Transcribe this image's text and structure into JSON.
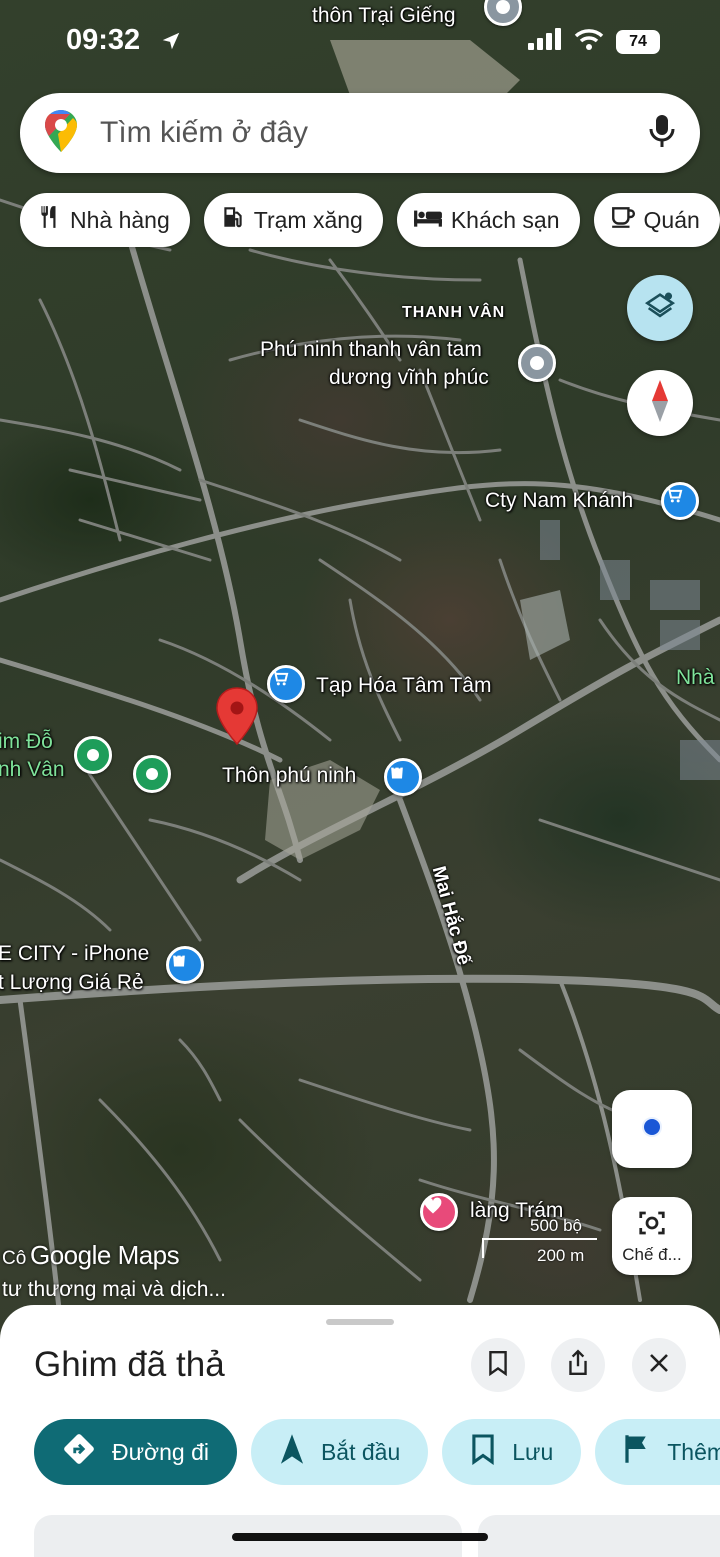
{
  "status_bar": {
    "time": "09:32",
    "battery": "74"
  },
  "search": {
    "placeholder": "Tìm kiếm ở đây"
  },
  "chips": [
    {
      "label": "Nhà hàng",
      "icon": "restaurant-icon"
    },
    {
      "label": "Trạm xăng",
      "icon": "gas-station-icon"
    },
    {
      "label": "Khách sạn",
      "icon": "hotel-icon"
    },
    {
      "label": "Quán",
      "icon": "cafe-icon"
    }
  ],
  "map": {
    "labels": {
      "trai_gieng": "thôn Trại Giếng",
      "thanh_van": "THANH VÂN",
      "phu_ninh_1": "Phú ninh thanh vân tam",
      "phu_ninh_2": "dương vĩnh phúc",
      "cty_nam_khanh": "Cty Nam Khánh",
      "tap_hoa": "Tạp Hóa Tâm Tâm",
      "thon_phu_ninh": "Thôn phú ninh",
      "mai_hac_de": "Mai Hắc Đế",
      "city_iphone_1": "E CITY - iPhone",
      "city_iphone_2": "t Lượng Giá Rẻ",
      "im_do_1": "im Đỗ",
      "im_do_2": "nh Vân",
      "nha": "Nhà",
      "lang_tram": "làng Trám"
    },
    "scale": {
      "imperial": "500 bộ",
      "metric": "200 m"
    },
    "brand": "Google Maps",
    "attribution_prefix": "Cô",
    "attribution": "tư thương mại và dịch..."
  },
  "lens": {
    "label": "Chế đ..."
  },
  "sheet": {
    "title": "Ghim đã thả",
    "actions": [
      {
        "label": "Đường đi",
        "icon": "directions-icon"
      },
      {
        "label": "Bắt đầu",
        "icon": "navigation-icon"
      },
      {
        "label": "Lưu",
        "icon": "bookmark-icon"
      },
      {
        "label": "Thêm",
        "icon": "flag-icon"
      }
    ]
  },
  "colors": {
    "accent": "#0f6b75",
    "chip_bg": "#c8eef6",
    "poi_blue": "#1e88e5",
    "pin_red": "#e53935"
  }
}
